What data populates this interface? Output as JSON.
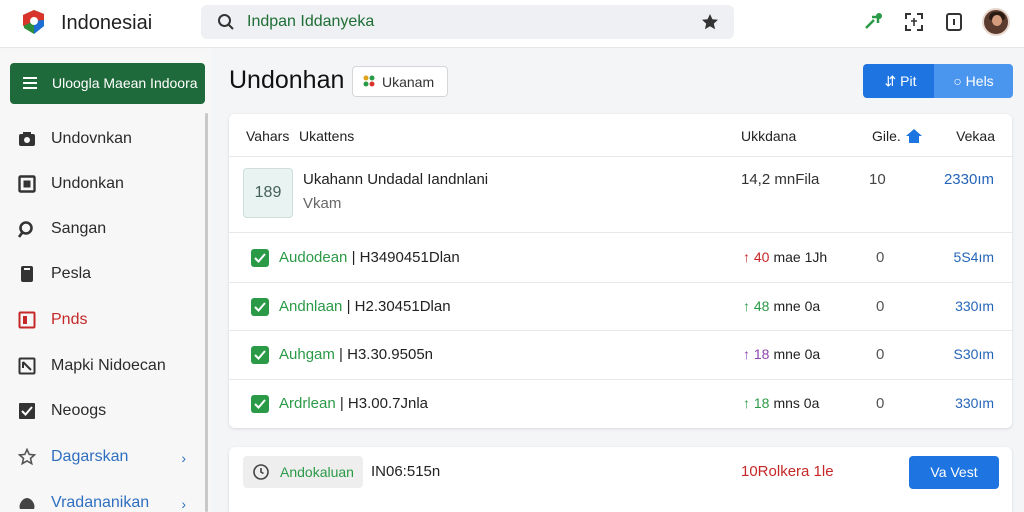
{
  "app": {
    "title": "Indonesiai"
  },
  "search": {
    "value": "Indpan Iddanyeka"
  },
  "sidebar": {
    "primary_label": "Ulooglа Maean Indoora",
    "items": [
      {
        "label": "Undovnkan",
        "icon": "camera-icon"
      },
      {
        "label": "Undonkan",
        "icon": "square-icon"
      },
      {
        "label": "Sangan",
        "icon": "search-icon"
      },
      {
        "label": "Pesla",
        "icon": "phone-icon"
      },
      {
        "label": "Pnds",
        "icon": "flag-icon",
        "color": "#c62828"
      },
      {
        "label": "Mapki Nidoecan",
        "icon": "external-icon"
      },
      {
        "label": "Neoogs",
        "icon": "checkbox-icon"
      },
      {
        "label": "Dagarskan",
        "icon": "star-icon",
        "color": "#2f6fc0"
      },
      {
        "label": "Vradananikan",
        "icon": "cloud-icon",
        "color": "#2f6fc0"
      }
    ]
  },
  "main": {
    "title": "Undonhan",
    "chip_label": "Ukanam",
    "seg": {
      "a": "Pit",
      "b": "Hels"
    }
  },
  "table": {
    "headers": {
      "col1": "Vahars",
      "col2": "Ukattens",
      "col3": "Ukkdana",
      "col4": "Gile.",
      "col5": "Vekaa"
    },
    "first": {
      "thumb": "189",
      "title": "Ukahann Undadal Iandnlani",
      "sub": "Vkam",
      "size": "14,2 mnFila",
      "count": "10",
      "value": "2330ım"
    },
    "rows": [
      {
        "green": "Audodean",
        "code": " | H3490451Dlan",
        "trend": "↑ 40",
        "time": "mae 1Jh",
        "trend_color": "#c62828",
        "count": "0",
        "value": "5S4ım"
      },
      {
        "green": "Andnlaan",
        "code": " | H2.30451Dlan",
        "trend": "↑ 48",
        "time": "mne 0a",
        "trend_color": "#2b9a47",
        "count": "0",
        "value": "330ım"
      },
      {
        "green": "Auhgam",
        "code": " | H3.30.9505n",
        "trend": "↑ 18",
        "time": "mne 0a",
        "trend_color": "#8e44ad",
        "count": "0",
        "value": "S30ım"
      },
      {
        "green": "Ardrlean",
        "code": " | H3.00.7Jnla",
        "trend": "↑ 18",
        "time": "mns 0a",
        "trend_color": "#2b9a47",
        "count": "0",
        "value": "330ım"
      }
    ]
  },
  "footer_card": {
    "pill": "Andokaluan",
    "code": "IN06:515n",
    "warn": "10Rolkera 1le",
    "button": "Va Vest"
  }
}
